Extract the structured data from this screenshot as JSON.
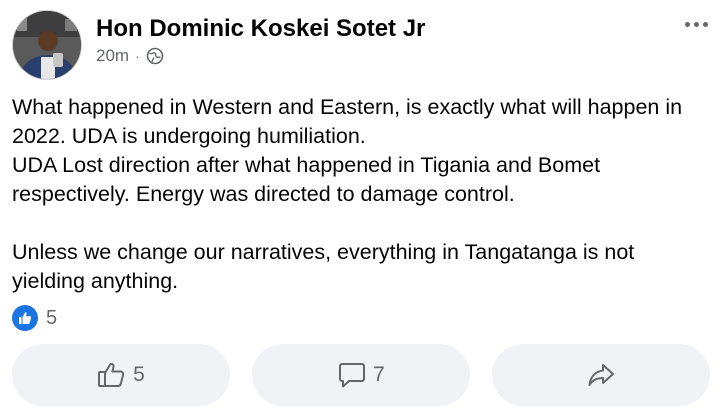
{
  "post": {
    "author": "Hon Dominic Koskei Sotet Jr",
    "time": "20m",
    "separator": "·",
    "audience_icon": "globe-icon",
    "more_icon": "more-horizontal-icon",
    "text": "What happened in Western and Eastern, is exactly what will happen in 2022. UDA is undergoing humiliation.\nUDA Lost direction after what happened in Tigania and Bomet respectively. Energy was directed to damage control.\n\nUnless we change our narratives, everything in Tangatanga is not yielding anything."
  },
  "reactions": {
    "icon": "like-reaction-icon",
    "count": "5"
  },
  "actions": {
    "like": {
      "icon": "thumbs-up-icon",
      "count": "5"
    },
    "comment": {
      "icon": "comment-icon",
      "count": "7"
    },
    "share": {
      "icon": "share-icon"
    }
  },
  "colors": {
    "text": "#050505",
    "secondary": "#65676b",
    "button_bg": "#f0f2f5",
    "like_blue": "#1b74e4"
  }
}
